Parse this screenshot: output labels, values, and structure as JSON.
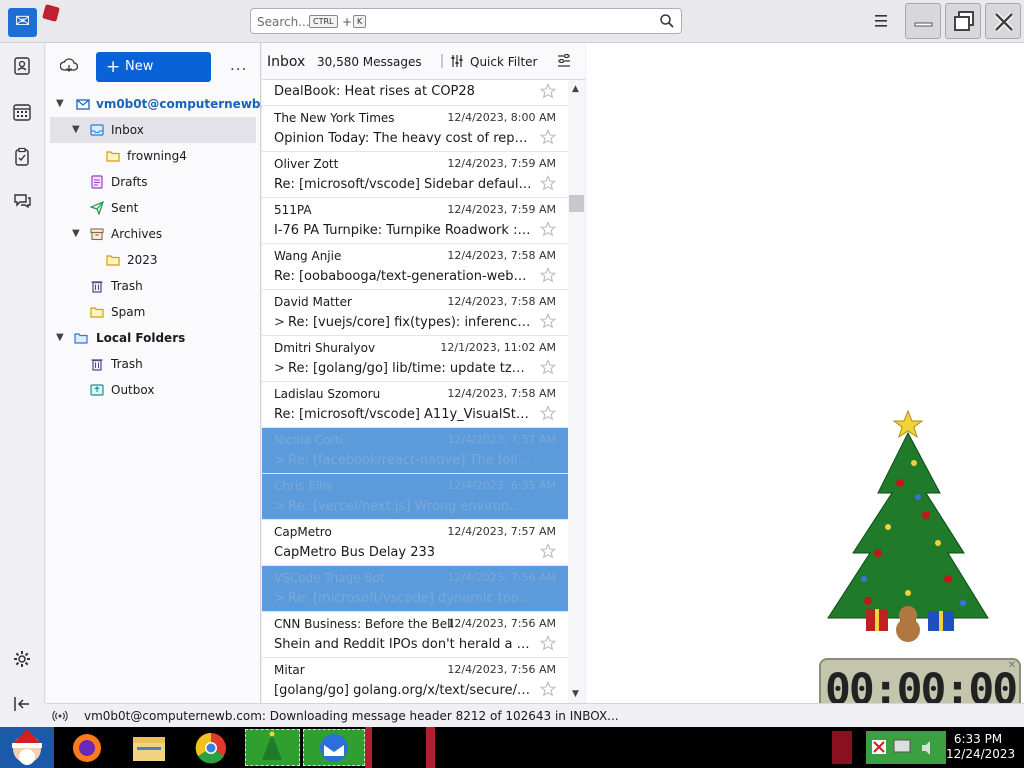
{
  "search": {
    "placeholder": "Search...",
    "key1": "CTRL",
    "plus": "+",
    "key2": "K"
  },
  "toolbar": {
    "new_message": "New Message",
    "new_message_plus": "+",
    "more": "..."
  },
  "folders": {
    "account": "vm0b0t@computernewb...",
    "items": [
      {
        "label": "Inbox"
      },
      {
        "label": "frowning4"
      },
      {
        "label": "Drafts"
      },
      {
        "label": "Sent"
      },
      {
        "label": "Archives"
      },
      {
        "label": "2023"
      },
      {
        "label": "Trash"
      },
      {
        "label": "Spam"
      }
    ],
    "local_folders": "Local Folders",
    "local_items": [
      {
        "label": "Trash"
      },
      {
        "label": "Outbox"
      }
    ]
  },
  "list": {
    "title": "Inbox",
    "count": "30,580 Messages",
    "quick_filter": "Quick Filter",
    "messages": [
      {
        "sender": "",
        "date": "",
        "subject": "DealBook: Heat rises at COP28"
      },
      {
        "sender": "The New York Times",
        "date": "12/4/2023, 8:00 AM",
        "subject": "Opinion Today: The heavy cost of reportin..."
      },
      {
        "sender": "Oliver Zott",
        "date": "12/4/2023, 7:59 AM",
        "subject": "Re: [microsoft/vscode] Sidebar defaultWid..."
      },
      {
        "sender": "511PA",
        "date": "12/4/2023, 7:59 AM",
        "subject": "I-76 PA Turnpike: Turnpike Roadwork : INITI..."
      },
      {
        "sender": "Wang Anjie",
        "date": "12/4/2023, 7:58 AM",
        "subject": "Re: [oobabooga/text-generation-webui] A..."
      },
      {
        "sender": "David Matter",
        "date": "12/4/2023, 7:58 AM",
        "subject": "Re: [vuejs/core] fix(types): inference for ..."
      },
      {
        "sender": "Dmitri Shuralyov",
        "date": "12/1/2023, 11:02 AM",
        "subject": "Re: [golang/go] lib/time: update tzdata ..."
      },
      {
        "sender": "Ladislau Szomoru",
        "date": "12/4/2023, 7:58 AM",
        "subject": "Re: [microsoft/vscode] A11y_VisualStudioC..."
      },
      {
        "sender": "Nicola Corti",
        "date": "12/4/2023, 7:57 AM",
        "subject": "Re: [facebook/react-native] The followin..."
      },
      {
        "sender": "Chris Ellis",
        "date": "12/4/2023, 6:35 AM",
        "subject": "Re: [vercel/next.js] Wrong environment v..."
      },
      {
        "sender": "CapMetro",
        "date": "12/4/2023, 7:57 AM",
        "subject": "CapMetro Bus Delay 233"
      },
      {
        "sender": "VSCode Triage Bot",
        "date": "12/4/2023, 7:56 AM",
        "subject": "Re: [microsoft/vscode] dynamic tooltip (..."
      },
      {
        "sender": "CNN Business: Before the Bell",
        "date": "12/4/2023, 7:56 AM",
        "subject": "Shein and Reddit IPOs don't herald a Wall ..."
      },
      {
        "sender": "Mitar",
        "date": "12/4/2023, 7:56 AM",
        "subject": "[golang/go] golang.org/x/text/secure/prec..."
      }
    ]
  },
  "status": {
    "text": "vm0b0t@computernewb.com: Downloading message header 8212 of 102643 in INBOX..."
  },
  "clock_widget": {
    "time": "00:00:00"
  },
  "taskbar": {
    "time": "6:33 PM",
    "date": "12/24/2023"
  },
  "colors": {
    "accent": "#0a62d8",
    "selected_row": "#5b9bdb",
    "account": "#1c62b9"
  }
}
